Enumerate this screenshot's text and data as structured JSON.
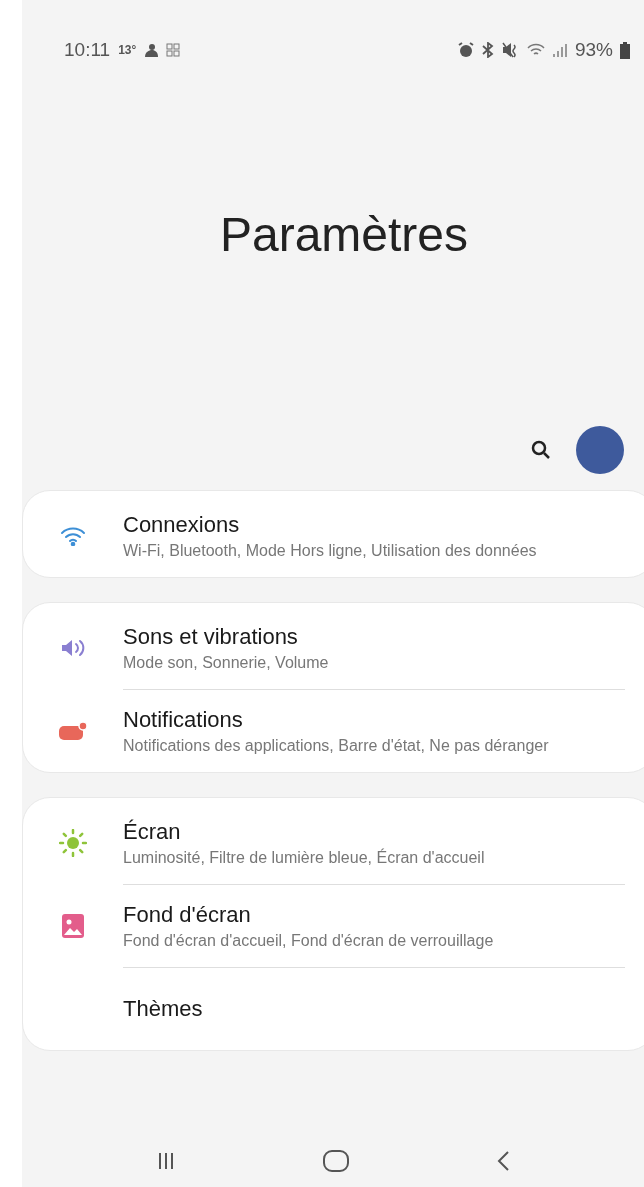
{
  "status_bar": {
    "time": "10:11",
    "temperature": "13°",
    "battery": "93%"
  },
  "title": "Paramètres",
  "cards": [
    {
      "items": [
        {
          "title": "Connexions",
          "subtitle": "Wi-Fi, Bluetooth, Mode Hors ligne, Utilisation des données"
        }
      ]
    },
    {
      "items": [
        {
          "title": "Sons et vibrations",
          "subtitle": "Mode son, Sonnerie, Volume"
        },
        {
          "title": "Notifications",
          "subtitle": "Notifications des applications, Barre d'état, Ne pas déranger"
        }
      ]
    },
    {
      "items": [
        {
          "title": "Écran",
          "subtitle": "Luminosité, Filtre de lumière bleue, Écran d'accueil"
        },
        {
          "title": "Fond d'écran",
          "subtitle": "Fond d'écran d'accueil, Fond d'écran de verrouillage"
        },
        {
          "title": "Thèmes"
        }
      ]
    }
  ]
}
